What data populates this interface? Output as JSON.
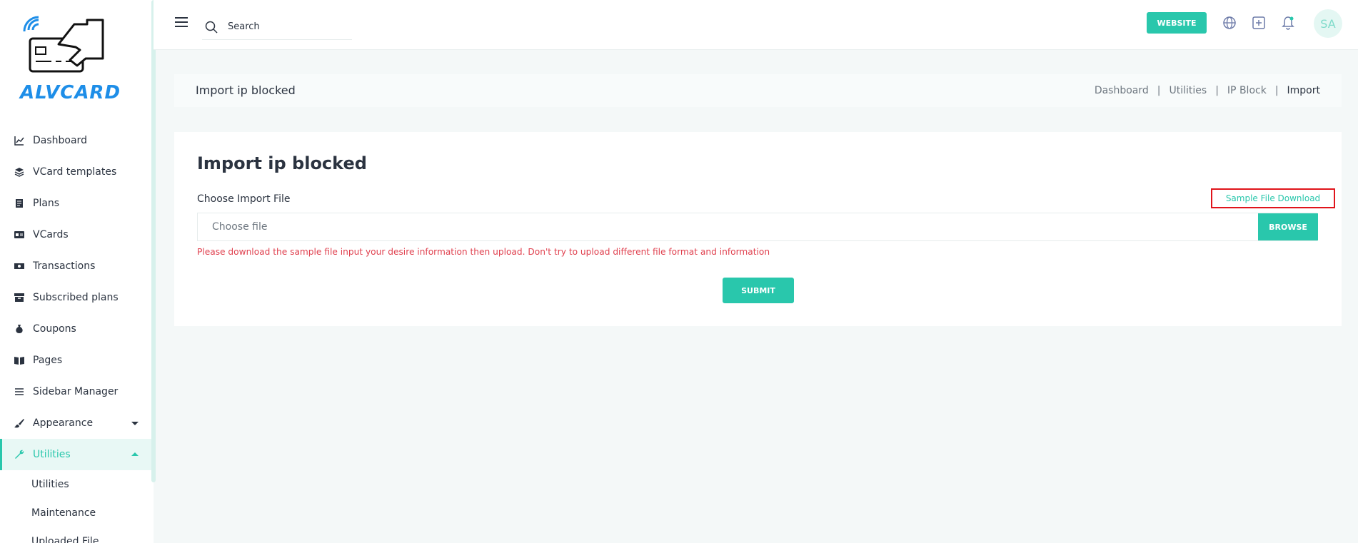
{
  "brand": {
    "name": "ALVCARD"
  },
  "topbar": {
    "search_placeholder": "Search",
    "website_label": "WEBSITE",
    "avatar_initials": "SA"
  },
  "sidebar": {
    "items": [
      {
        "label": "Dashboard",
        "icon": "chart-line-icon"
      },
      {
        "label": "VCard templates",
        "icon": "layers-icon"
      },
      {
        "label": "Plans",
        "icon": "document-icon"
      },
      {
        "label": "VCards",
        "icon": "id-card-icon"
      },
      {
        "label": "Transactions",
        "icon": "money-icon"
      },
      {
        "label": "Subscribed plans",
        "icon": "archive-icon"
      },
      {
        "label": "Coupons",
        "icon": "money-bag-icon"
      },
      {
        "label": "Pages",
        "icon": "book-icon"
      },
      {
        "label": "Sidebar Manager",
        "icon": "list-icon"
      },
      {
        "label": "Appearance",
        "icon": "brush-icon"
      },
      {
        "label": "Utilities",
        "icon": "wrench-icon"
      }
    ],
    "sub_items": [
      "Utilities",
      "Maintenance",
      "Uploaded File"
    ]
  },
  "page_header": {
    "title": "Import ip blocked",
    "breadcrumb": [
      "Dashboard",
      "Utilities",
      "IP Block",
      "Import"
    ]
  },
  "card": {
    "title": "Import ip blocked",
    "field_label": "Choose Import File",
    "sample_link": "Sample File Download",
    "file_placeholder": "Choose file",
    "browse_label": "BROWSE",
    "help_text": "Please download the sample file input your desire information then upload. Don't try to upload different file format and information",
    "submit_label": "SUBMIT"
  },
  "colors": {
    "accent": "#29c7ac",
    "brand_blue": "#1e8ee8",
    "error": "#e0414f",
    "highlight_border": "#e0141b"
  }
}
